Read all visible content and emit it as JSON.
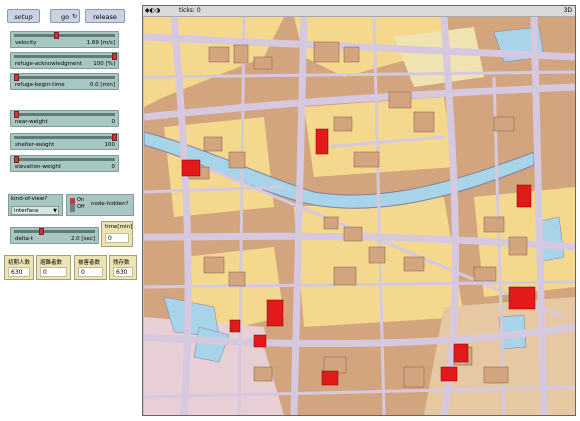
{
  "buttons": {
    "setup": "setup",
    "go": "go",
    "release": "release"
  },
  "sliders": [
    {
      "label": "velocity",
      "value": "1.69 [m/s]",
      "level": 0.42
    },
    {
      "label": "refuge-acknowledgment",
      "value": "100 [%]",
      "level": 1.0
    },
    {
      "label": "refuge-begin-time",
      "value": "0.0 [min]",
      "level": 0.0
    },
    {
      "label": "near-weight",
      "value": "0",
      "level": 0.0
    },
    {
      "label": "shelter-weight",
      "value": "100",
      "level": 1.0
    },
    {
      "label": "elevation-weight",
      "value": "0",
      "level": 0.0
    },
    {
      "label": "delta-t",
      "value": "2.0 [sec]",
      "level": 0.2
    }
  ],
  "chooser": {
    "label": "kind-of-view?",
    "value": "interface"
  },
  "switch": {
    "on": "On",
    "off": "Off",
    "label": "node-hidden?"
  },
  "monitors": {
    "time": {
      "label": "time[min]",
      "value": "0"
    },
    "initial": {
      "label": "初期人数",
      "value": "630"
    },
    "evacuated": {
      "label": "避難者数",
      "value": "0"
    },
    "damaged": {
      "label": "被害者数",
      "value": "0"
    },
    "remaining": {
      "label": "残存数",
      "value": "630"
    }
  },
  "view": {
    "controls": "◆◐◑",
    "ticks": "ticks: 0",
    "speed": "3D"
  },
  "colors": {
    "street": "#d6c8df",
    "building": "#d2a57e",
    "block": "#f4d88e",
    "shelter": "#e31a1a",
    "river": "#a8d4ea"
  }
}
